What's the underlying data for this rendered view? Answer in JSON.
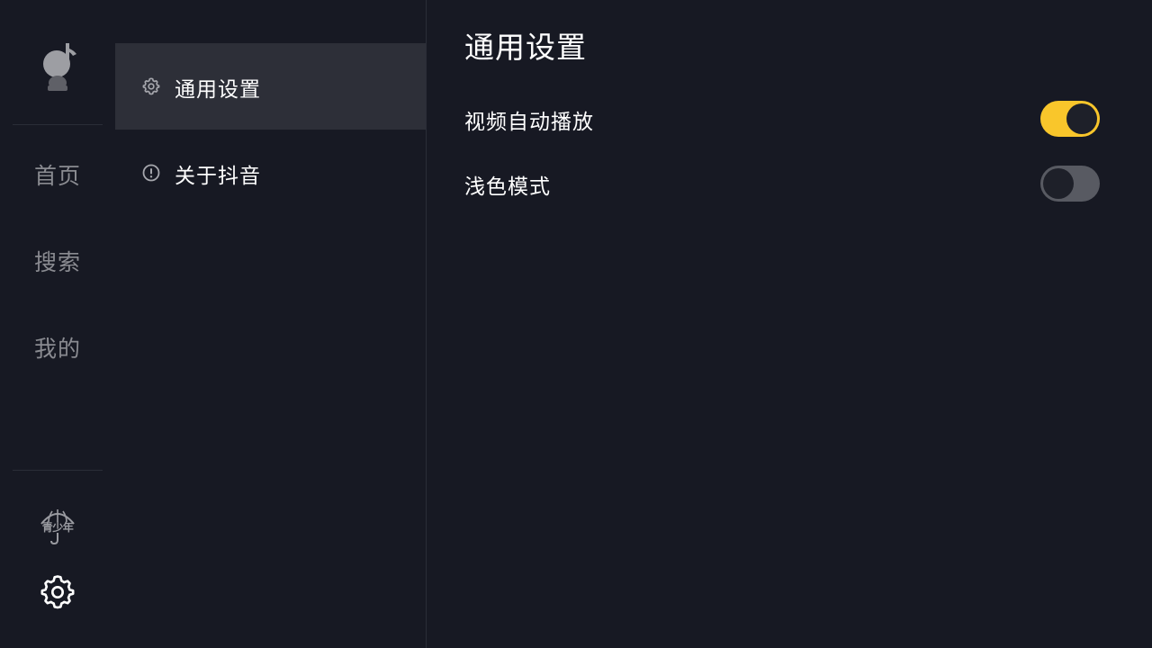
{
  "rail": {
    "nav": [
      {
        "label": "首页"
      },
      {
        "label": "搜索"
      },
      {
        "label": "我的"
      }
    ],
    "teen_mode_label": "青少年",
    "settings_icon": "gear-icon",
    "avatar_icon": "mascot-avatar-icon"
  },
  "menu": {
    "items": [
      {
        "label": "通用设置",
        "icon": "gear-icon",
        "active": true
      },
      {
        "label": "关于抖音",
        "icon": "info-icon",
        "active": false
      }
    ]
  },
  "content": {
    "title": "通用设置",
    "settings": [
      {
        "label": "视频自动播放",
        "enabled": true
      },
      {
        "label": "浅色模式",
        "enabled": false
      }
    ]
  },
  "colors": {
    "background": "#171923",
    "active_item": "#2d2f38",
    "toggle_on": "#f9c62b",
    "toggle_off": "#585a62",
    "muted_text": "#8a8b91"
  }
}
